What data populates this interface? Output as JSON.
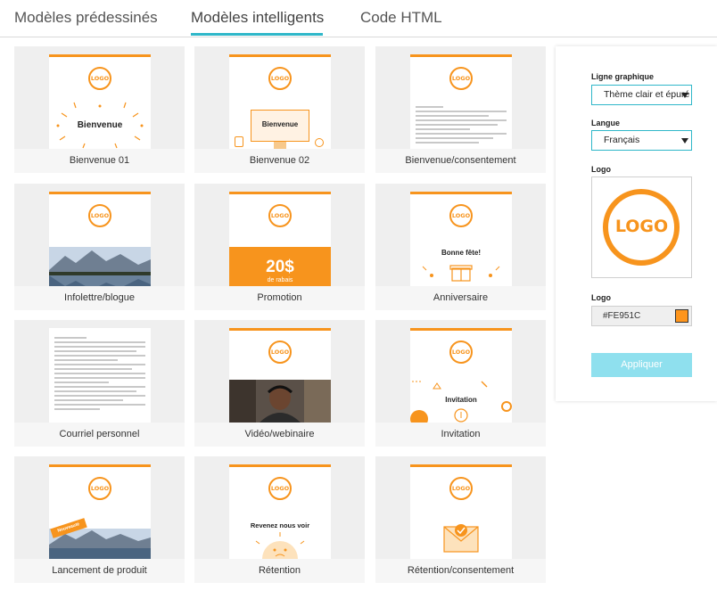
{
  "tabs": [
    {
      "label": "Modèles prédessinés"
    },
    {
      "label": "Modèles intelligents",
      "active": true
    },
    {
      "label": "Code HTML"
    }
  ],
  "accent_color": "#2fb7c9",
  "brand_color": "#f7941d",
  "logo_text": "LOGO",
  "templates": [
    {
      "label": "Bienvenue 01",
      "headline": "Bienvenue"
    },
    {
      "label": "Bienvenue 02",
      "headline": "Bienvenue"
    },
    {
      "label": "Bienvenue/consentement"
    },
    {
      "label": "Infolettre/blogue"
    },
    {
      "label": "Promotion",
      "headline": "20$",
      "subline": "de rabais"
    },
    {
      "label": "Anniversaire",
      "headline": "Bonne fête!"
    },
    {
      "label": "Courriel personnel"
    },
    {
      "label": "Vidéo/webinaire"
    },
    {
      "label": "Invitation",
      "headline": "Invitation"
    },
    {
      "label": "Lancement de produit",
      "badge": "Nouveauté"
    },
    {
      "label": "Rétention",
      "headline": "Revenez nous voir"
    },
    {
      "label": "Rétention/consentement"
    }
  ],
  "panel": {
    "graphic_line_label": "Ligne graphique",
    "graphic_line_value": "Thème clair et épuré",
    "language_label": "Langue",
    "language_value": "Français",
    "logo_label": "Logo",
    "logo_color_label": "Logo",
    "logo_color_value": "#FE951C",
    "apply_label": "Appliquer"
  }
}
